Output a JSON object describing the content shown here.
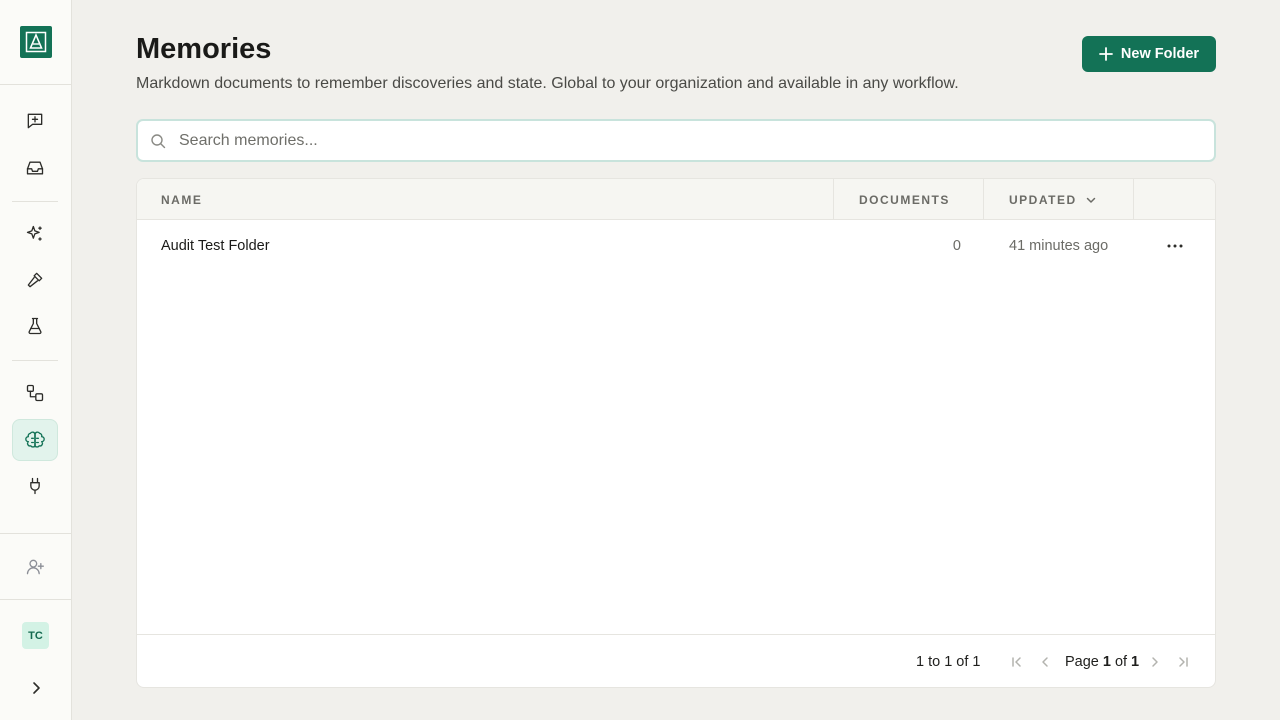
{
  "sidebar": {
    "items": [
      {
        "icon": "message-plus-icon"
      },
      {
        "icon": "inbox-icon"
      },
      {
        "icon": "sparkles-icon"
      },
      {
        "icon": "hammer-icon"
      },
      {
        "icon": "flask-icon"
      },
      {
        "icon": "workflow-icon"
      },
      {
        "icon": "brain-icon",
        "active": true
      },
      {
        "icon": "plug-icon"
      }
    ],
    "invite_icon": "user-plus-icon",
    "avatar_initials": "TC",
    "expand_icon": "chevron-right-icon"
  },
  "header": {
    "title": "Memories",
    "subtitle": "Markdown documents to remember discoveries and state. Global to your organization and available in any workflow.",
    "new_folder_label": "New Folder"
  },
  "search": {
    "placeholder": "Search memories..."
  },
  "table": {
    "columns": {
      "name": "NAME",
      "documents": "DOCUMENTS",
      "updated": "UPDATED"
    },
    "sort": {
      "column": "updated",
      "direction": "desc"
    },
    "rows": [
      {
        "name": "Audit Test Folder",
        "documents": "0",
        "updated": "41 minutes ago"
      }
    ],
    "footer": {
      "range": "1 to 1 of 1",
      "page_prefix": "Page",
      "page_current": "1",
      "page_of": "of",
      "page_total": "1"
    }
  },
  "colors": {
    "accent": "#137256",
    "active_nav_bg": "#e2f3ec",
    "background": "#f1f0ec"
  }
}
